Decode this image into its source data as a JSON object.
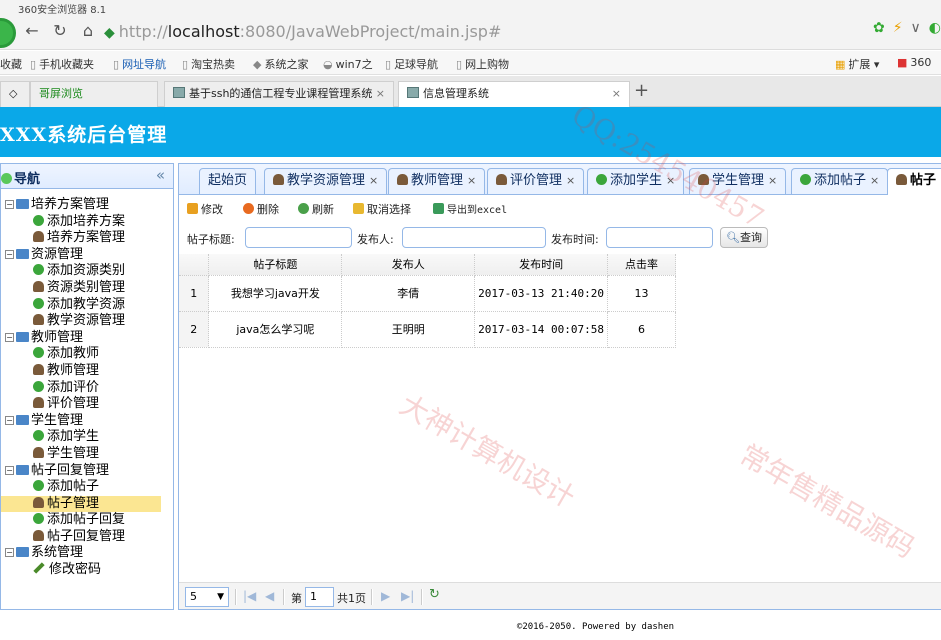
{
  "browser": {
    "window_title": "360安全浏览器 8.1",
    "url_protocol": "http://",
    "url_host": "localhost",
    "url_path": ":8080/JavaWebProject/main.jsp#",
    "favorites": [
      "收藏",
      "手机收藏夹",
      "网址导航",
      "淘宝热卖",
      "系统之家",
      "win7之",
      "足球导航",
      "网上购物"
    ],
    "ext_label": "扩展",
    "ext2_label": "360",
    "tabs": [
      {
        "label": "哥屏浏览"
      },
      {
        "label": "基于ssh的通信工程专业课程管理系统"
      },
      {
        "label": "信息管理系统"
      }
    ]
  },
  "app": {
    "header_title": "XXX系统后台管理",
    "sidebar_title": "导航",
    "tree": [
      {
        "label": "培养方案管理",
        "type": "parent"
      },
      {
        "label": "添加培养方案",
        "type": "add"
      },
      {
        "label": "培养方案管理",
        "type": "user"
      },
      {
        "label": "资源管理",
        "type": "parent"
      },
      {
        "label": "添加资源类别",
        "type": "add"
      },
      {
        "label": "资源类别管理",
        "type": "user"
      },
      {
        "label": "添加教学资源",
        "type": "add"
      },
      {
        "label": "教学资源管理",
        "type": "user"
      },
      {
        "label": "教师管理",
        "type": "parent"
      },
      {
        "label": "添加教师",
        "type": "add"
      },
      {
        "label": "教师管理",
        "type": "user"
      },
      {
        "label": "添加评价",
        "type": "add"
      },
      {
        "label": "评价管理",
        "type": "user"
      },
      {
        "label": "学生管理",
        "type": "parent"
      },
      {
        "label": "添加学生",
        "type": "add"
      },
      {
        "label": "学生管理",
        "type": "user"
      },
      {
        "label": "帖子回复管理",
        "type": "parent"
      },
      {
        "label": "添加帖子",
        "type": "add"
      },
      {
        "label": "帖子管理",
        "type": "user",
        "selected": true
      },
      {
        "label": "添加帖子回复",
        "type": "add"
      },
      {
        "label": "帖子回复管理",
        "type": "user"
      },
      {
        "label": "系统管理",
        "type": "parent"
      },
      {
        "label": "修改密码",
        "type": "pen"
      }
    ],
    "tabs": [
      {
        "label": "起始页",
        "icon": "none"
      },
      {
        "label": "教学资源管理",
        "icon": "user"
      },
      {
        "label": "教师管理",
        "icon": "user"
      },
      {
        "label": "评价管理",
        "icon": "user"
      },
      {
        "label": "添加学生",
        "icon": "add"
      },
      {
        "label": "学生管理",
        "icon": "user"
      },
      {
        "label": "添加帖子",
        "icon": "add"
      },
      {
        "label": "帖子",
        "icon": "user",
        "active": true
      }
    ],
    "toolbar": {
      "edit": "修改",
      "delete": "删除",
      "refresh": "刷新",
      "cancel": "取消选择",
      "export": "导出到excel"
    },
    "search": {
      "title_label": "帖子标题:",
      "author_label": "发布人:",
      "time_label": "发布时间:",
      "query": "查询"
    },
    "table": {
      "columns": [
        "帖子标题",
        "发布人",
        "发布时间",
        "点击率"
      ],
      "rows": [
        {
          "n": "1",
          "title": "我想学习java开发",
          "author": "李倩",
          "time": "2017-03-13 21:40:20",
          "clicks": "13"
        },
        {
          "n": "2",
          "title": "java怎么学习呢",
          "author": "王明明",
          "time": "2017-03-14 00:07:58",
          "clicks": "6"
        }
      ]
    },
    "pager": {
      "page_size": "5",
      "page_label": "第",
      "page_value": "1",
      "total": "共1页"
    },
    "footer": "©2016-2050. Powered by dashen"
  },
  "watermarks": [
    "QQ:254540457",
    "大神计算机设计",
    "常年售精品源码"
  ]
}
